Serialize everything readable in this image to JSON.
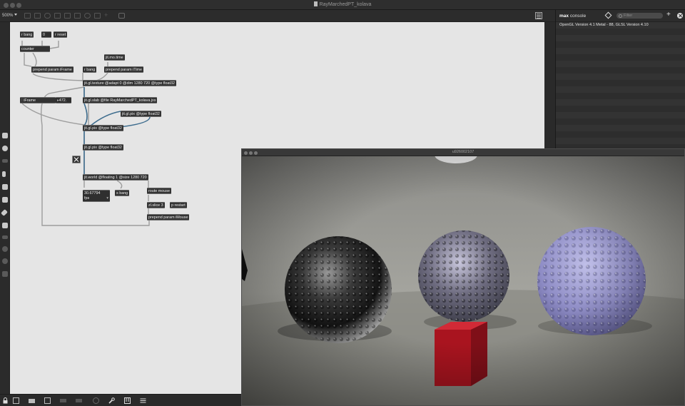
{
  "window": {
    "title": "RayMarchedPT_kolava",
    "zoom": "500%"
  },
  "console": {
    "title_brand": "max",
    "title_rest": " console",
    "filter_placeholder": "Filter",
    "add_label": "+",
    "lines": [
      "OpenGL Version 4.1 Metal - 88, GLSL Version 4.10"
    ]
  },
  "patcher": {
    "objects": {
      "r_bang_top": "r bang",
      "number_zero": "0",
      "r_reset": "r reset",
      "counter": "counter",
      "prepend_iframe": "prepend param iFrame",
      "r_bang_mid": "r bang",
      "jit_mo_time": "jit.mo.time",
      "prepend_itime": "prepend param iTime",
      "jit_gl_texture": "jit.gl.texture @adapt 0 @dim 1280 720 @type float32",
      "iframe_param": "iFrame",
      "iframe_value": "472.",
      "jit_gl_slab": "jit.gl.slab @file RayMarchedPT_kolava.jxs",
      "jit_gl_pix_a": "jit.gl.pix @type float32",
      "jit_gl_pix_b": "jit.gl.pix @type float32",
      "jit_gl_pix_c": "jit.gl.pix @type float32",
      "jit_world": "jit.world @floating 1 @size 1280 720",
      "fps_value": "30.67794",
      "fps_label": "fps",
      "s_bang": "s bang",
      "route_mouse": "route mouse",
      "zl_slice": "zl.slice 3",
      "p_restart": "p restart",
      "prepend_imouse": "prepend param iMouse"
    }
  },
  "render_window": {
    "title": "u926002107"
  }
}
